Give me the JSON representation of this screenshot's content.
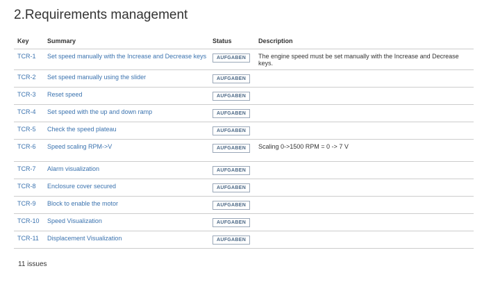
{
  "page": {
    "title": "2.Requirements management"
  },
  "table": {
    "columns": {
      "key": "Key",
      "summary": "Summary",
      "status": "Status",
      "description": "Description"
    },
    "rows": [
      {
        "key": "TCR-1",
        "summary": "Set speed manually with the Increase and Decrease keys",
        "status": "AUFGABEN",
        "description": "The engine speed must be set manually with the Increase and Decrease keys."
      },
      {
        "key": "TCR-2",
        "summary": "Set speed manually using the slider",
        "status": "AUFGABEN",
        "description": ""
      },
      {
        "key": "TCR-3",
        "summary": "Reset speed",
        "status": "AUFGABEN",
        "description": ""
      },
      {
        "key": "TCR-4",
        "summary": "Set speed with the up and down ramp",
        "status": "AUFGABEN",
        "description": ""
      },
      {
        "key": "TCR-5",
        "summary": "Check the speed plateau",
        "status": "AUFGABEN",
        "description": ""
      },
      {
        "key": "TCR-6",
        "summary": "Speed scaling RPM->V",
        "status": "AUFGABEN",
        "description": "Scaling 0->1500 RPM = 0 -> 7 V"
      },
      {
        "key": "TCR-7",
        "summary": "Alarm visualization",
        "status": "AUFGABEN",
        "description": ""
      },
      {
        "key": "TCR-8",
        "summary": "Enclosure cover secured",
        "status": "AUFGABEN",
        "description": ""
      },
      {
        "key": "TCR-9",
        "summary": "Block to enable the motor",
        "status": "AUFGABEN",
        "description": ""
      },
      {
        "key": "TCR-10",
        "summary": "Speed Visualization",
        "status": "AUFGABEN",
        "description": ""
      },
      {
        "key": "TCR-11",
        "summary": "Displacement Visualization",
        "status": "AUFGABEN",
        "description": ""
      }
    ]
  },
  "footer": {
    "count": "11 issues"
  },
  "colors": {
    "link": "#3b73af",
    "status_border": "#9aa7b8",
    "status_text": "#4a6785",
    "rule": "#cccccc"
  }
}
